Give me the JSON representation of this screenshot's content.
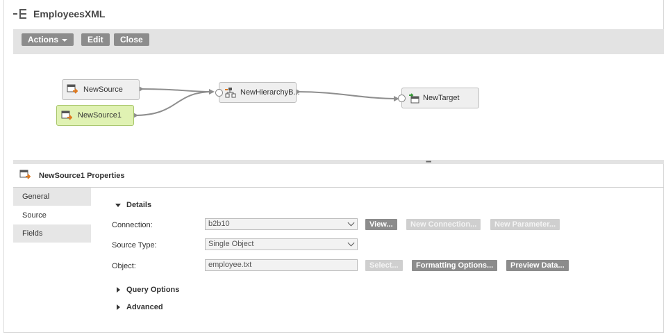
{
  "header": {
    "title": "EmployeesXML",
    "icon": "mapping-icon"
  },
  "toolbar": {
    "actions": "Actions",
    "edit": "Edit",
    "close": "Close"
  },
  "canvas": {
    "nodes": {
      "source": "NewSource",
      "source1": "NewSource1",
      "hierarchy": "NewHierarchyB...",
      "target": "NewTarget"
    }
  },
  "properties": {
    "title": "NewSource1 Properties",
    "tabs": [
      "General",
      "Source",
      "Fields"
    ],
    "active_tab": "Source",
    "details": {
      "label": "Details",
      "connection_label": "Connection:",
      "connection_value": "b2b10",
      "source_type_label": "Source Type:",
      "source_type_value": "Single Object",
      "object_label": "Object:",
      "object_value": "employee.txt",
      "buttons": {
        "view": "View...",
        "new_connection": "New Connection...",
        "new_parameter": "New Parameter...",
        "select": "Select...",
        "formatting_options": "Formatting Options...",
        "preview_data": "Preview Data..."
      }
    },
    "query_options": "Query Options",
    "advanced": "Advanced"
  },
  "colors": {
    "toolbar_bg": "#e3e3e3",
    "button_bg": "#8c8c8c",
    "selected_node": "#e0f2b3"
  }
}
